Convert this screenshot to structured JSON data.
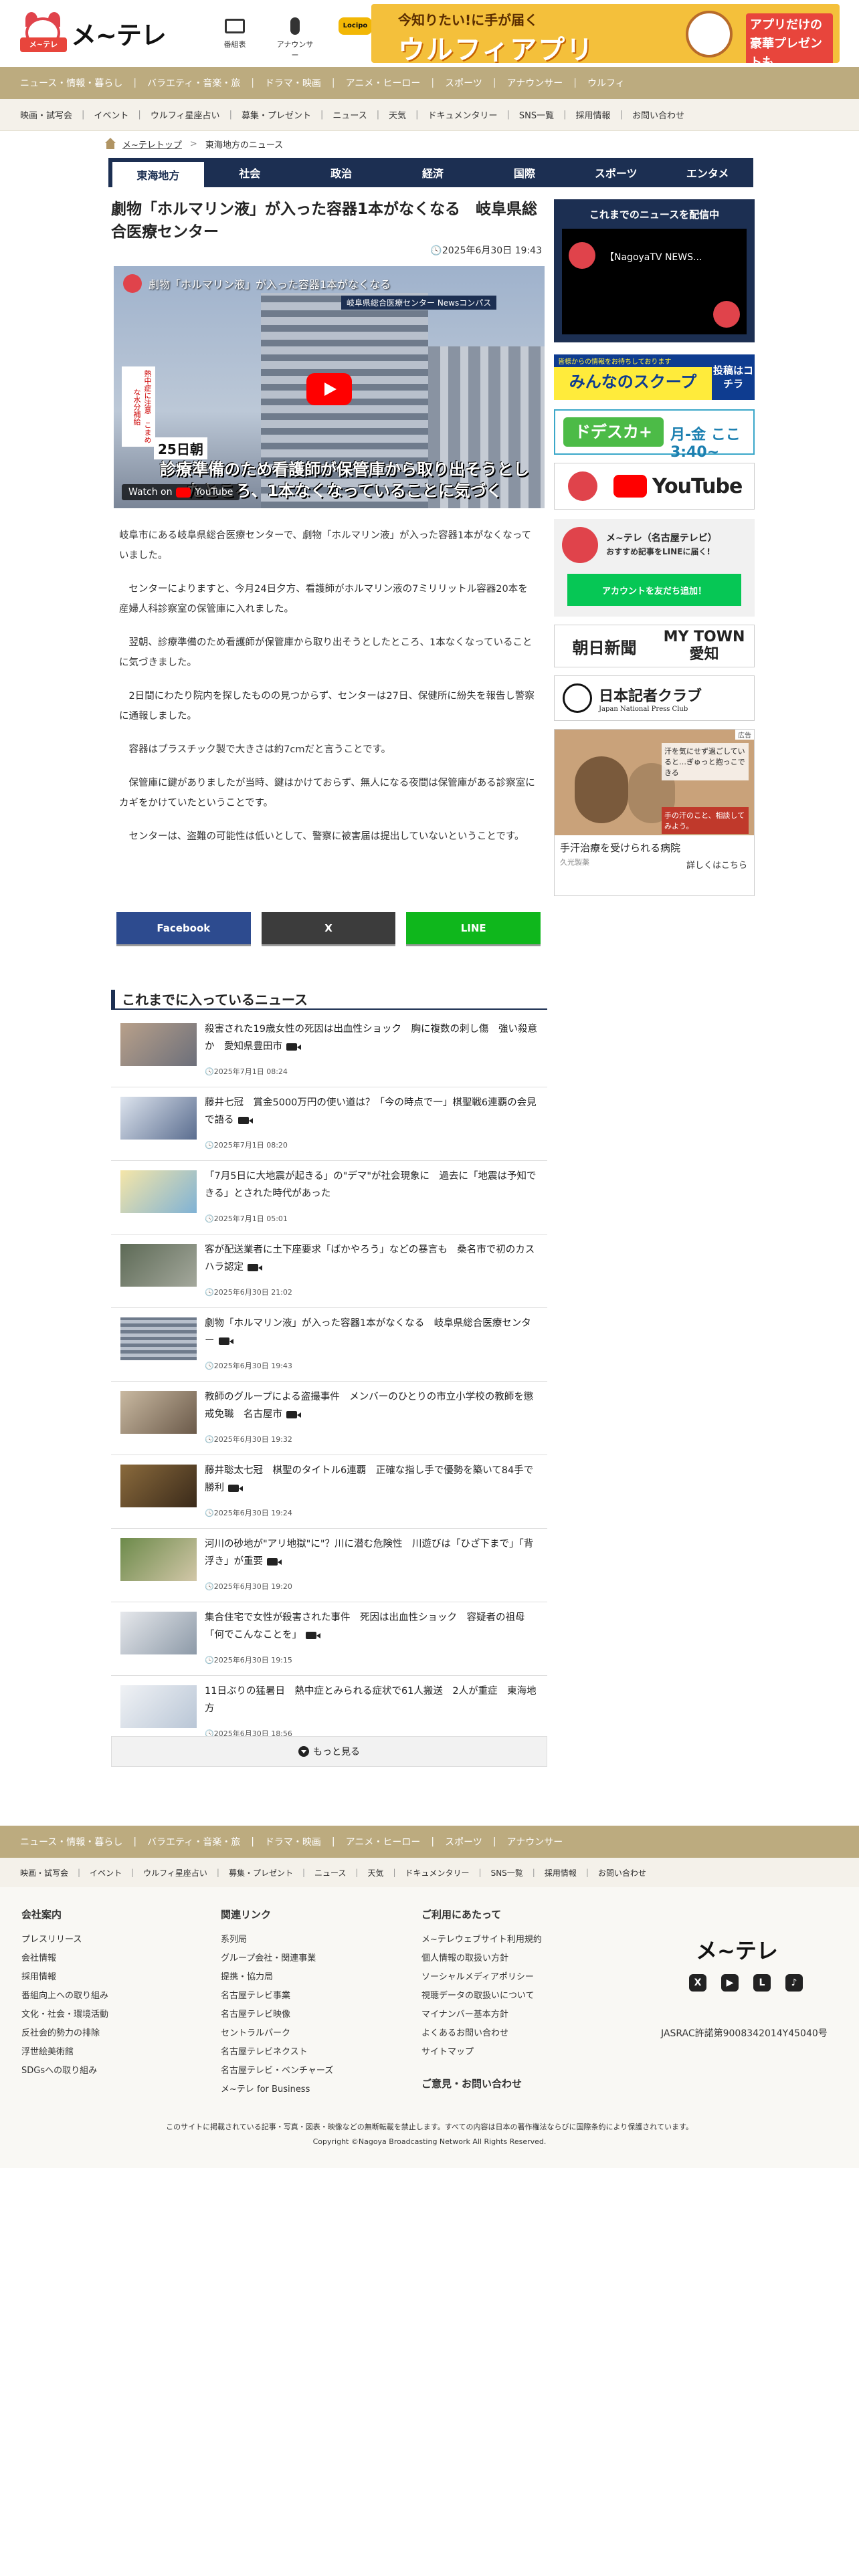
{
  "header": {
    "brand": "メ~テレ",
    "mascot_tag": "メ~テレ",
    "icons": [
      {
        "label": "番組表",
        "icon": "tv-icon"
      },
      {
        "label": "アナウンサー",
        "icon": "mic-icon"
      },
      {
        "label": "Locipo",
        "icon": "locipo-icon"
      }
    ],
    "banner": {
      "line1": "今知りたい!に手が届く",
      "line2": "ウルフィアプリ",
      "line3": "アプリだけの豪華プレゼントも"
    }
  },
  "global_nav": [
    "ニュース・情報・暮らし",
    "バラエティ・音楽・旅",
    "ドラマ・映画",
    "アニメ・ヒーロー",
    "スポーツ",
    "アナウンサー",
    "ウルフィ"
  ],
  "sub_nav": [
    "映画・試写会",
    "イベント",
    "ウルフィ星座占い",
    "募集・プレゼント",
    "ニュース",
    "天気",
    "ドキュメンタリー",
    "SNS一覧",
    "採用情報",
    "お問い合わせ"
  ],
  "breadcrumb": {
    "home": "メ~テレトップ",
    "current": "東海地方のニュース"
  },
  "category_tabs": [
    "東海地方",
    "社会",
    "政治",
    "経済",
    "国際",
    "スポーツ",
    "エンタメ"
  ],
  "article": {
    "title": "劇物「ホルマリン液」が入った容器1本がなくなる　岐阜県総合医療センター",
    "date": "2025年6月30日 19:43",
    "video": {
      "title": "劇物「ホルマリン液」が入った容器1本がなくなる",
      "subtitle": "岐阜県総合医療センター  Newsコンパス",
      "side_text": "熱中症に注意　こまめな水分補給",
      "day": "25日朝",
      "caption": "診療準備のため看護師が保管庫から取り出そうとしたところ、1本なくなっていることに気づく",
      "watch": "Watch on",
      "watch_brand": "YouTube"
    },
    "paragraphs": [
      "岐阜市にある岐阜県総合医療センターで、劇物「ホルマリン液」が入った容器1本がなくなっていました。",
      "　センターによりますと、今月24日夕方、看護師がホルマリン液の7ミリリットル容器20本を産婦人科診察室の保管庫に入れました。",
      "　翌朝、診療準備のため看護師が保管庫から取り出そうとしたところ、1本なくなっていることに気づきました。",
      "　2日間にわたり院内を探したものの見つからず、センターは27日、保健所に紛失を報告し警察に通報しました。",
      "　容器はプラスチック製で大きさは約7cmだと言うことです。",
      "　保管庫に鍵がありましたが当時、鍵はかけておらず、無人になる夜間は保管庫がある診察室にカギをかけていたということです。",
      "　センターは、盗難の可能性は低いとして、警察に被害届は提出していないということです。"
    ]
  },
  "share": {
    "facebook": "Facebook",
    "x": "X",
    "line": "LINE"
  },
  "sidebar": {
    "news_stream": {
      "heading": "これまでのニュースを配信中",
      "screen_title": "【NagoyaTV NEWS..."
    },
    "scoop": {
      "tag": "皆様からの情報をお待ちしております",
      "title": "みんなのスクープ",
      "cta": "投稿はコチラ"
    },
    "dosu": {
      "title": "ドデスカ+",
      "time": "月-金 ここ3:40~"
    },
    "youtube": {
      "label": "YouTube"
    },
    "line": {
      "title": "メ~テレ（名古屋テレビ）",
      "subtitle": "おすすめ記事をLINEに届く!",
      "button": "アカウントを友だち追加！"
    },
    "asahi": {
      "left": "朝日新聞",
      "right": "MY TOWN 愛知"
    },
    "jnpc": {
      "title": "日本記者クラブ",
      "subtitle": "Japan National Press Club"
    },
    "ad": {
      "badge": "広告",
      "msg": "汗を気にせず過ごしていると…ぎゅっと抱っこできる",
      "msg2": "手の汗のこと、相談してみよう。",
      "title": "手汗治療を受けられる病院",
      "source": "久光製薬",
      "link": "詳しくはこちら"
    }
  },
  "news": {
    "heading": "これまでに入っているニュース",
    "items": [
      {
        "title": "殺害された19歳女性の死因は出血性ショック　胸に複数の刺し傷　強い殺意か　愛知県豊田市",
        "time": "2025年7月1日 08:24",
        "video": true
      },
      {
        "title": "藤井七冠　賞金5000万円の使い道は？「今の時点で一」棋聖戦6連覇の会見で語る",
        "time": "2025年7月1日 08:20",
        "video": true
      },
      {
        "title": "「7月5日に大地震が起きる」の\"デマ\"が社会現象に　過去に「地震は予知できる」とされた時代があった",
        "time": "2025年7月1日 05:01",
        "video": false
      },
      {
        "title": "客が配送業者に土下座要求「ばかやろう」などの暴言も　桑名市で初のカスハラ認定",
        "time": "2025年6月30日 21:02",
        "video": true
      },
      {
        "title": "劇物「ホルマリン液」が入った容器1本がなくなる　岐阜県総合医療センター",
        "time": "2025年6月30日 19:43",
        "video": true
      },
      {
        "title": "教師のグループによる盗撮事件　メンバーのひとりの市立小学校の教師を懲戒免職　名古屋市",
        "time": "2025年6月30日 19:32",
        "video": true
      },
      {
        "title": "藤井聡太七冠　棋聖のタイトル6連覇　正確な指し手で優勢を築いて84手で勝利",
        "time": "2025年6月30日 19:24",
        "video": true
      },
      {
        "title": "河川の砂地が\"アリ地獄\"に\"？川に潜む危険性　川遊びは「ひざ下まで」「背浮き」が重要",
        "time": "2025年6月30日 19:20",
        "video": true
      },
      {
        "title": "集合住宅で女性が殺害された事件　死因は出血性ショック　容疑者の祖母「何でこんなことを」",
        "time": "2025年6月30日 19:15",
        "video": true
      },
      {
        "title": "11日ぶりの猛暑日　熱中症とみられる症状で61人搬送　2人が重症　東海地方",
        "time": "2025年6月30日 18:56",
        "video": false
      }
    ],
    "more": "もっと見る"
  },
  "footer": {
    "nav": [
      "ニュース・情報・暮らし",
      "バラエティ・音楽・旅",
      "ドラマ・映画",
      "アニメ・ヒーロー",
      "スポーツ",
      "アナウンサー"
    ],
    "sub_nav": [
      "映画・試写会",
      "イベント",
      "ウルフィ星座占い",
      "募集・プレゼント",
      "ニュース",
      "天気",
      "ドキュメンタリー",
      "SNS一覧",
      "採用情報",
      "お問い合わせ"
    ],
    "col1": {
      "heading": "会社案内",
      "items": [
        "プレスリリース",
        "会社情報",
        "採用情報",
        "番組向上への取り組み",
        "文化・社会・環境活動",
        "反社会的勢力の排除",
        "浮世絵美術館",
        "SDGsへの取り組み"
      ]
    },
    "col2": {
      "heading": "関連リンク",
      "items": [
        "系列局",
        "グループ会社・関連事業",
        "提携・協力局",
        "名古屋テレビ事業",
        "名古屋テレビ映像",
        "セントラルパーク",
        "名古屋テレビネクスト",
        "名古屋テレビ・ベンチャーズ",
        "メ~テレ for Business"
      ]
    },
    "col3": {
      "heading": "ご利用にあたって",
      "items": [
        "メ~テレウェブサイト利用規約",
        "個人情報の取扱い方針",
        "ソーシャルメディアポリシー",
        "視聴データの取扱いについて",
        "マイナンバー基本方針",
        "よくあるお問い合わせ",
        "サイトマップ"
      ],
      "extra": "ご意見・お問い合わせ"
    },
    "logo": "メ~テレ",
    "social": [
      "X",
      "▶",
      "L",
      "♪"
    ],
    "jasrac": "JASRAC許諾第9008342014Y45040号",
    "note": "このサイトに掲載されている記事・写真・図表・映像などの無断転載を禁止します。すべての内容は日本の著作権法ならびに国際条約により保護されています。",
    "copyright": "Copyright ©Nagoya Broadcasting Network All Rights Reserved."
  }
}
